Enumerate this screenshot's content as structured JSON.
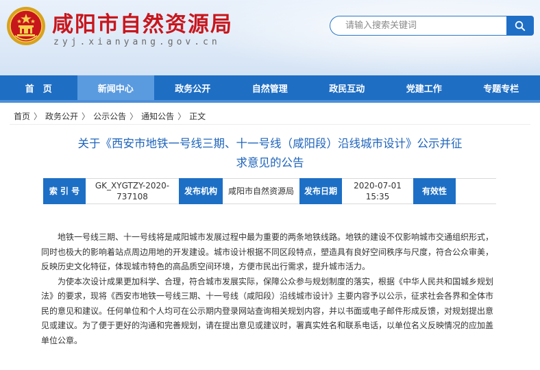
{
  "header": {
    "title": "咸阳市自然资源局",
    "domain": "zyj.xianyang.gov.cn",
    "search_placeholder": "请输入搜索关键词"
  },
  "nav": {
    "items": [
      {
        "label": "首　页"
      },
      {
        "label": "新闻中心"
      },
      {
        "label": "政务公开"
      },
      {
        "label": "自然管理"
      },
      {
        "label": "政民互动"
      },
      {
        "label": "党建工作"
      },
      {
        "label": "专题专栏"
      }
    ],
    "active_index": 1
  },
  "breadcrumb": [
    "首页",
    "政务公开",
    "公示公告",
    "通知公告",
    "正文"
  ],
  "breadcrumb_separator": "〉",
  "article": {
    "title_line1": "关于《西安市地铁一号线三期、十一号线（咸阳段）沿线城市设计》公示并征",
    "title_line2": "求意见的公告",
    "meta": {
      "index_label": "索 引 号",
      "index_value_line1": "GK_XYGTZY-2020-",
      "index_value_line2": "737108",
      "org_label": "发布机构",
      "org_value": "咸阳市自然资源局",
      "date_label": "发布日期",
      "date_value_line1": "2020-07-01",
      "date_value_line2": "15:35",
      "validity_label": "有效性"
    },
    "paragraphs": [
      "地铁一号线三期、十一号线将是咸阳城市发展过程中最为重要的两条地铁线路。地铁的建设不仅影响城市交通组织形式，同时也极大的影响着站点周边用地的开发建设。城市设计根据不同区段特点，塑造具有良好空间秩序与尺度，符合公众审美，反映历史文化特征，体现城市特色的高品质空间环境，方便市民出行需求，提升城市活力。",
      "为使本次设计成果更加科学、合理，符合城市发展实际，保障公众参与规划制度的落实，根据《中华人民共和国城乡规划法》的要求，现将《西安市地铁一号线三期、十一号线（咸阳段）沿线城市设计》主要内容予以公示，征求社会各界和全体市民的意见和建议。任何单位和个人均可在公示期内登录网站查询相关规划内容，并以书面或电子邮件形成反馈，对规划提出意见或建议。为了便于更好的沟通和完善规划，请在提出意见或建议时，署真实姓名和联系电话，以单位名义反映情况的应加盖单位公章。"
    ]
  },
  "colors": {
    "brand_red": "#c8161d",
    "nav_blue": "#1e6ec4",
    "nav_active": "#5a9be0",
    "title_blue": "#1e64bb"
  },
  "icons": {
    "emblem": "national-emblem-icon",
    "search": "search-icon"
  }
}
